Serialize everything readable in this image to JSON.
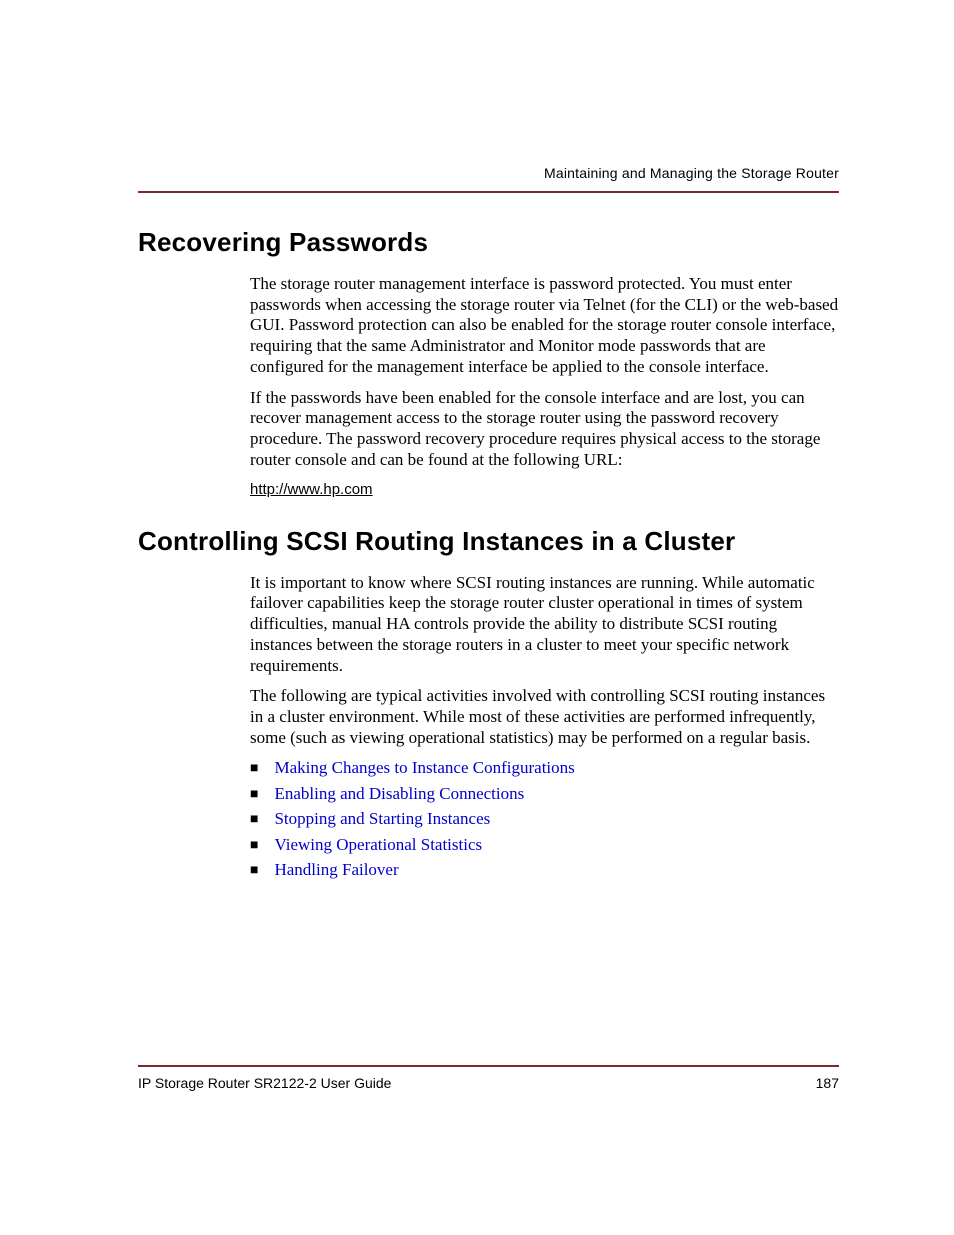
{
  "header": {
    "running": "Maintaining and Managing the Storage Router"
  },
  "section1": {
    "title": "Recovering Passwords",
    "p1": "The storage router management interface is password protected. You must enter passwords when accessing the storage router via Telnet (for the CLI) or the web-based GUI. Password protection can also be enabled for the storage router console interface, requiring that the same Administrator and Monitor mode passwords that are configured for the management interface be applied to the console interface.",
    "p2": "If the passwords have been enabled for the console interface and are lost, you can recover management access to the storage router using the password recovery procedure. The password recovery procedure requires physical access to the storage router console and can be found at the following URL:",
    "url": "http://www.hp.com"
  },
  "section2": {
    "title": "Controlling SCSI Routing Instances in a Cluster",
    "p1": "It is important to know where SCSI routing instances are running. While automatic failover capabilities keep the storage router cluster operational in times of system difficulties, manual HA controls provide the ability to distribute SCSI routing instances between the storage routers in a cluster to meet your specific network requirements.",
    "p2": "The following are typical activities involved with controlling SCSI routing instances in a cluster environment. While most of these activities are performed infrequently, some (such as viewing operational statistics) may be performed on a regular basis.",
    "bullets": [
      "Making Changes to Instance Configurations",
      "Enabling and Disabling Connections",
      "Stopping and Starting Instances",
      "Viewing Operational Statistics",
      "Handling Failover"
    ]
  },
  "footer": {
    "left": "IP Storage Router SR2122-2 User Guide",
    "right": "187"
  }
}
